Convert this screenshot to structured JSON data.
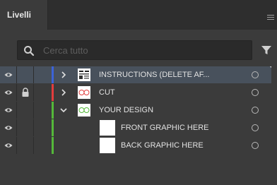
{
  "panel": {
    "tab_label": "Livelli"
  },
  "search": {
    "placeholder": "Cerca tutto",
    "value": ""
  },
  "colors": {
    "blue": "#3c63d8",
    "red": "#e23d3d",
    "green": "#55b83a",
    "selected_row": "#48515c"
  },
  "layers": [
    {
      "name": "INSTRUCTIONS (delete af...",
      "color": "blue",
      "visible": true,
      "locked": false,
      "expanded": false,
      "selected": true
    },
    {
      "name": "CUT",
      "color": "red",
      "visible": true,
      "locked": true,
      "expanded": false,
      "selected": false
    },
    {
      "name": "YOUR DESIGN",
      "color": "green",
      "visible": true,
      "locked": false,
      "expanded": true,
      "selected": false
    },
    {
      "name": "FRONT GRAPHIC HERE",
      "color": "green",
      "visible": true,
      "locked": false,
      "expanded": false,
      "selected": false,
      "sublayer": true
    },
    {
      "name": "BACK GRAPHIC HERE",
      "color": "green",
      "visible": true,
      "locked": false,
      "expanded": false,
      "selected": false,
      "sublayer": true
    }
  ]
}
